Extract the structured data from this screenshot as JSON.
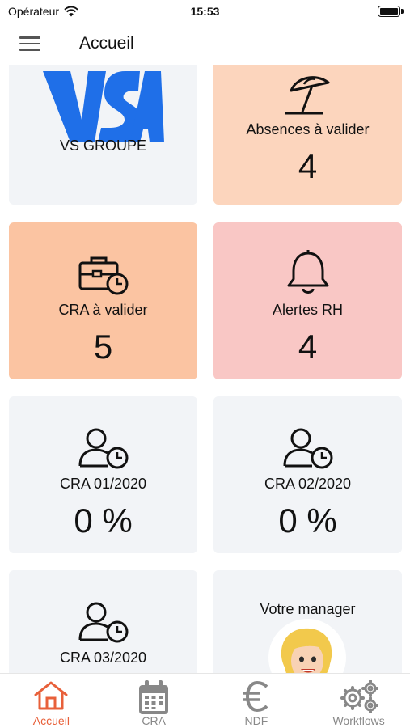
{
  "status_bar": {
    "carrier": "Opérateur",
    "time": "15:53"
  },
  "header": {
    "title": "Accueil"
  },
  "company": {
    "name": "VS GROUPE"
  },
  "cards": {
    "absences": {
      "label": "Absences à valider",
      "value": "4"
    },
    "cra_validate": {
      "label": "CRA à valider",
      "value": "5"
    },
    "alerts": {
      "label": "Alertes RH",
      "value": "4"
    },
    "cra_jan": {
      "label": "CRA 01/2020",
      "value": "0 %"
    },
    "cra_feb": {
      "label": "CRA 02/2020",
      "value": "0 %"
    },
    "cra_mar": {
      "label": "CRA 03/2020"
    },
    "manager": {
      "label": "Votre manager"
    }
  },
  "tabs": [
    {
      "label": "Accueil",
      "icon": "home-icon",
      "active": true
    },
    {
      "label": "CRA",
      "icon": "calendar-icon",
      "active": false
    },
    {
      "label": "NDF",
      "icon": "euro-icon",
      "active": false
    },
    {
      "label": "Workflows",
      "icon": "gears-icon",
      "active": false
    }
  ],
  "colors": {
    "accent": "#e8603a",
    "logo_blue": "#1f6fe8",
    "card_grey": "#f2f4f7",
    "card_orange_light": "#fcd5bd",
    "card_orange": "#fbc4a2",
    "card_pink": "#f9c7c5"
  }
}
